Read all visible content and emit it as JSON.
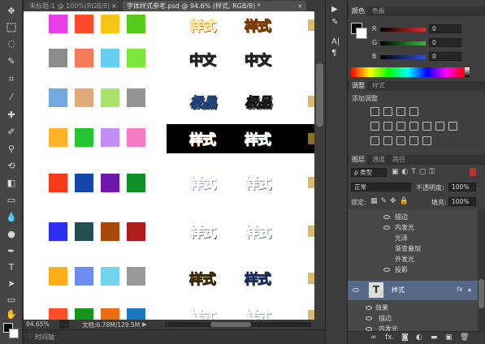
{
  "tabs": {
    "inactive_label": "未标题-1 @ 100%(RGB/8)",
    "active_label": "字体样式参考.psd @ 94.6% (样式, RGB/8) *",
    "close_glyph": "×"
  },
  "canvas": {
    "swatch_rows": [
      [
        "#e83ee6",
        "#fd4a2b",
        "#f6c214",
        "#56cb1b"
      ],
      [
        "#8c8c8c",
        "#f7795a",
        "#68cdef",
        "#7be73c"
      ],
      [
        "#72a9e2",
        "#e2aa78",
        "#a9e26b",
        "#949494"
      ],
      [
        "#fdb22a",
        "#25c533",
        "#c08ef5",
        "#f87cc3"
      ],
      [
        "#f63a17",
        "#1646a9",
        "#6f18ac",
        "#108f27"
      ],
      [
        "#2c2ef1",
        "#225054",
        "#a8480a",
        "#b01b1b"
      ],
      [
        "#ffac19",
        "#6b8df3",
        "#72d4ee",
        "#9a9a9a"
      ],
      [
        "#ff4d26",
        "#17951a",
        "#eb6b0e",
        "#1c79c0"
      ]
    ],
    "text_rows": [
      [
        "样式",
        "样式"
      ],
      [
        "中文",
        "中文"
      ],
      [
        "极品",
        "极品"
      ],
      [
        "样式",
        "样式"
      ],
      [
        "样式",
        "样式"
      ],
      [
        "样式",
        "样式"
      ],
      [
        "样式",
        "样式"
      ],
      [
        "样式",
        "样式"
      ]
    ]
  },
  "status": {
    "zoom": "94.65%",
    "doc": "文档:6.78M/129.5M",
    "timeline": "时间轴"
  },
  "color_panel": {
    "tabs": [
      "颜色",
      "色板"
    ],
    "channels": [
      {
        "label": "R",
        "value": "0",
        "color": "#e03030"
      },
      {
        "label": "G",
        "value": "0",
        "color": "#30c030"
      },
      {
        "label": "B",
        "value": "0",
        "color": "#3050e0"
      }
    ]
  },
  "adjust_panel": {
    "tabs": [
      "调整",
      "样式"
    ],
    "title": "添加调整"
  },
  "layers_panel": {
    "tabs": [
      "图层",
      "通道",
      "路径"
    ],
    "filter_label": "ρ 类型",
    "blend_mode": "正常",
    "opacity_label": "不透明度:",
    "opacity_value": "100%",
    "lock_label": "锁定:",
    "fill_label": "填充:",
    "fill_value": "100%",
    "effects_above": [
      "描边",
      "内发光",
      "光泽",
      "渐变叠加",
      "外发光",
      "投影"
    ],
    "selected_layer": "样式",
    "fx": "fx",
    "effects_below_header": "效果",
    "effects_below": [
      "描边",
      "内发光"
    ]
  },
  "colors": {
    "accent_selected": "#546887"
  }
}
